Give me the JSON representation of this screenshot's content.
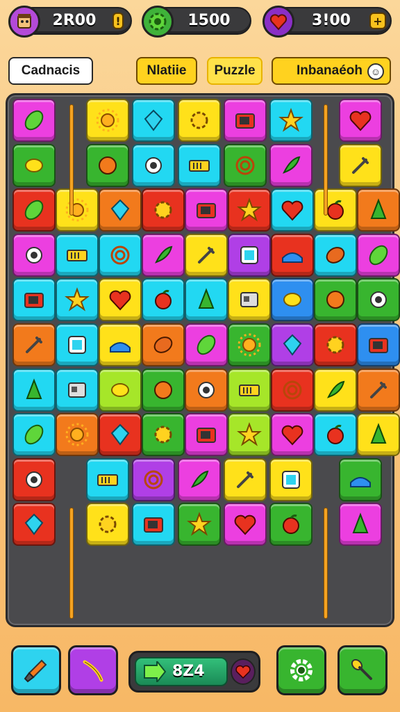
{
  "resources": [
    {
      "icon": "avatar-icon",
      "value": "2R00"
    },
    {
      "icon": "gear-coin-icon",
      "value": "1500"
    },
    {
      "icon": "heart-gem-icon",
      "value": "3!00"
    }
  ],
  "tabs": [
    {
      "label": "Cadnacis"
    },
    {
      "label": "Nlatiie"
    },
    {
      "label": "Puzzle"
    },
    {
      "label": "Inbanaéoh"
    }
  ],
  "bottom": {
    "counter": "8Z4",
    "buttons": [
      "brush-icon",
      "wand-icon",
      "gear-icon",
      "racket-icon"
    ]
  },
  "colors": {
    "magenta": "#ec3fe0",
    "yellow": "#ffe11a",
    "cyan": "#22d8f2",
    "green": "#38b52f",
    "red": "#e8321f",
    "orange": "#f27a1c",
    "purple": "#b03fe6",
    "lime": "#a6e629",
    "blue": "#2e8ff0"
  }
}
